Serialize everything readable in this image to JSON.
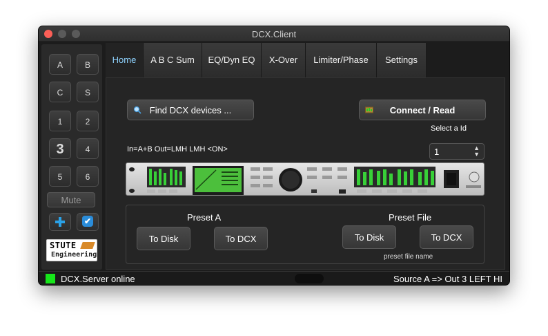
{
  "window": {
    "title": "DCX.Client"
  },
  "sidebar": {
    "buttons": [
      "A",
      "B",
      "C",
      "S",
      "1",
      "2",
      "3",
      "4",
      "5",
      "6"
    ],
    "mute_label": "Mute",
    "logo": {
      "line1": "STUTE",
      "line2": "Engineering"
    }
  },
  "tabs": [
    "Home",
    "A B C Sum",
    "EQ/Dyn EQ",
    "X-Over",
    "Limiter/Phase",
    "Settings"
  ],
  "active_tab": "Home",
  "home": {
    "find_button": "Find DCX devices ...",
    "connect_button": "Connect / Read",
    "select_id_label": "Select a Id",
    "select_id_value": "1",
    "routing_text": "In=A+B  Out=LMH LMH <ON>",
    "preset_a": {
      "title": "Preset A",
      "to_disk": "To Disk",
      "to_dcx": "To DCX"
    },
    "preset_file": {
      "title": "Preset File",
      "to_disk": "To Disk",
      "to_dcx": "To DCX",
      "file_name": "preset file name"
    }
  },
  "status": {
    "server_text": "DCX.Server online",
    "route_text": "Source A => Out 3 LEFT HI",
    "led_color": "#16e61a"
  },
  "colors": {
    "accent_tab": "#8fd3ff",
    "close_button": "#fc5f57"
  }
}
